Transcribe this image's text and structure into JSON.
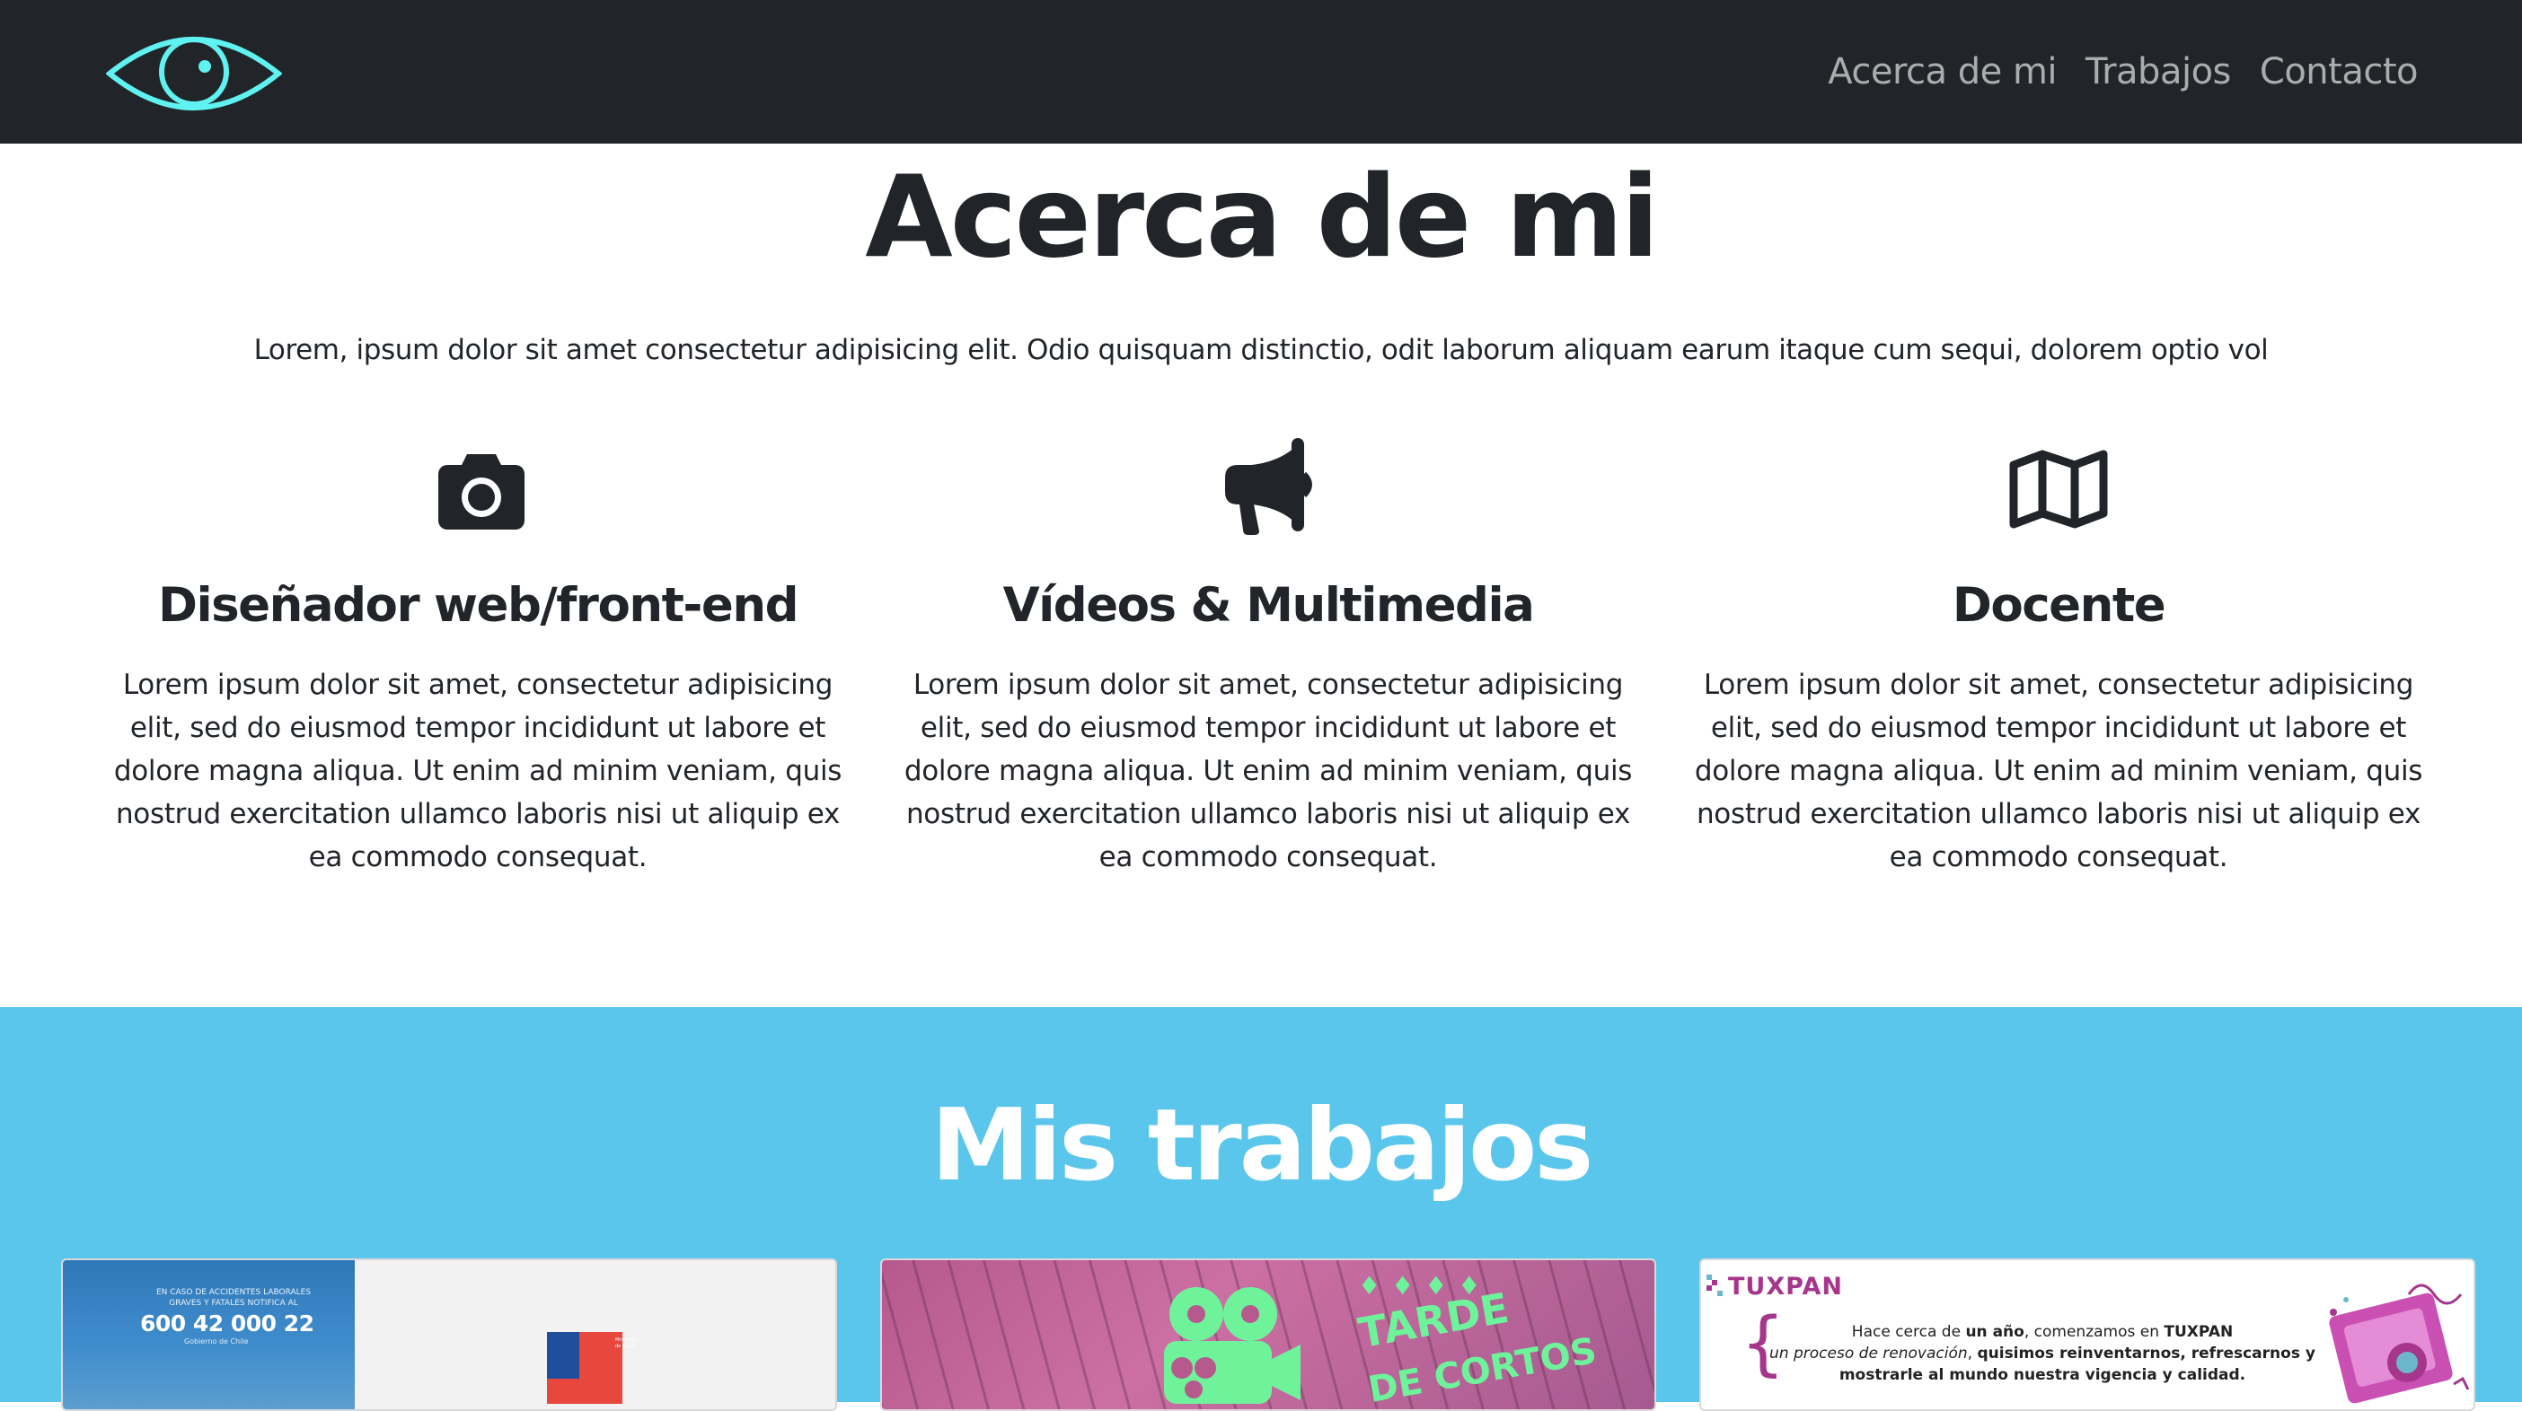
{
  "nav": {
    "logo": "eye-logo",
    "links": [
      "Acerca de mi",
      "Trabajos",
      "Contacto"
    ]
  },
  "about": {
    "title": "Acerca de mi",
    "intro": "Lorem, ipsum dolor sit amet consectetur adipisicing elit. Odio quisquam distinctio, odit laborum aliquam earum itaque cum sequi, dolorem optio vol",
    "features": [
      {
        "icon": "camera-icon",
        "title": "Diseñador web/front-end",
        "text": "Lorem ipsum dolor sit amet, consectetur adipisicing elit, sed do eiusmod tempor incididunt ut labore et dolore magna aliqua. Ut enim ad minim veniam, quis nostrud exercitation ullamco laboris nisi ut aliquip ex ea commodo consequat."
      },
      {
        "icon": "megaphone-icon",
        "title": "Vídeos & Multimedia",
        "text": "Lorem ipsum dolor sit amet, consectetur adipisicing elit, sed do eiusmod tempor incididunt ut labore et dolore magna aliqua. Ut enim ad minim veniam, quis nostrud exercitation ullamco laboris nisi ut aliquip ex ea commodo consequat."
      },
      {
        "icon": "map-icon",
        "title": "Docente",
        "text": "Lorem ipsum dolor sit amet, consectetur adipisicing elit, sed do eiusmod tempor incididunt ut labore et dolore magna aliqua. Ut enim ad minim veniam, quis nostrud exercitation ullamco laboris nisi ut aliquip ex ea commodo consequat."
      }
    ]
  },
  "works": {
    "title": "Mis trabajos",
    "cards": [
      {
        "small": "EN CASO DE ACCIDENTES LABORALES GRAVES Y FATALES NOTIFICA AL",
        "number": "600 42 000 22",
        "sub": "Gobierno de Chile",
        "gov_text": "Ministerio de Salud"
      },
      {
        "line1": "TARDE",
        "line2": "DE CORTOS"
      },
      {
        "brand": "TUXPAN",
        "text_1": "Hace cerca de ",
        "text_b1": "un año",
        "text_2": ", comenzamos en ",
        "text_b2": "TUXPAN",
        "text_i": "un proceso de renovación",
        "text_3": ", ",
        "text_b3": "quisimos reinventarnos, refrescarnos y mostrarle al mundo nuestra vigencia y calidad."
      }
    ]
  },
  "colors": {
    "navbar": "#212529",
    "accent": "#5bc6ec",
    "logo": "#5ff2f0",
    "tuxpan": "#a6368c",
    "cortos": "#6ff39a"
  }
}
